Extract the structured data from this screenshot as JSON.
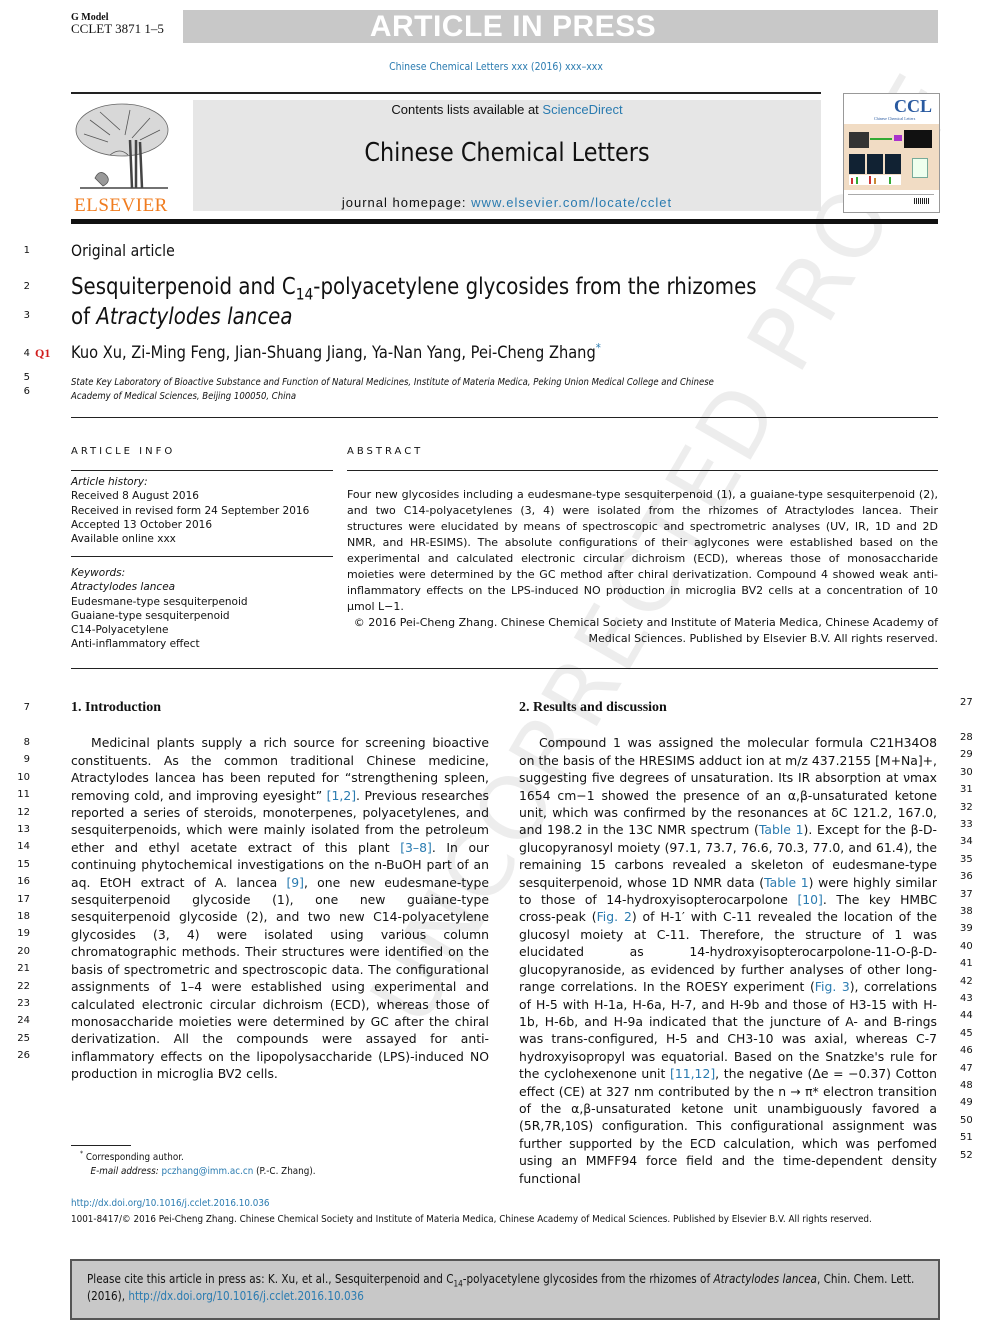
{
  "banner": {
    "g_model": "G Model",
    "manuscript_id": "CCLET 3871 1–5",
    "article_in_press": "ARTICLE IN PRESS",
    "journal_ref": "Chinese Chemical Letters xxx (2016) xxx–xxx"
  },
  "header": {
    "publisher_logo_text": "ELSEVIER",
    "contents_prefix": "Contents lists available at ",
    "contents_link": "ScienceDirect",
    "journal_title": "Chinese Chemical Letters",
    "homepage_prefix": "journal homepage: ",
    "homepage_link": "www.elsevier.com/locate/cclet",
    "cover_title": "CCL",
    "cover_subtitle": "Chinese Chemical Letters"
  },
  "article": {
    "type": "Original article",
    "title_line1_a": "Sesquiterpenoid and C",
    "title_sub": "14",
    "title_line1_b": "-polyacetylene glycosides from the rhizomes",
    "title_line2_a": "of ",
    "title_line2_italic": "Atractylodes lancea",
    "query_mark": "Q1",
    "authors": "Kuo Xu, Zi-Ming Feng, Jian-Shuang Jiang, Ya-Nan Yang, Pei-Cheng Zhang",
    "corresponding_mark": "*",
    "affiliation_line1": "State Key Laboratory of Bioactive Substance and Function of Natural Medicines, Institute of Materia Medica, Peking Union Medical College and Chinese",
    "affiliation_line2": "Academy of Medical Sciences, Beijing 100050, China"
  },
  "article_info": {
    "heading": "ARTICLE INFO",
    "history_label": "Article history:",
    "history": [
      "Received 8 August 2016",
      "Received in revised form 24 September 2016",
      "Accepted 13 October 2016",
      "Available online xxx"
    ],
    "keywords_label": "Keywords:",
    "keywords": [
      "Atractylodes lancea",
      "Eudesmane-type sesquiterpenoid",
      "Guaiane-type sesquiterpenoid",
      "C14-Polyacetylene",
      "Anti-inflammatory effect"
    ]
  },
  "abstract": {
    "heading": "ABSTRACT",
    "text": "Four new glycosides including a eudesmane-type sesquiterpenoid (1), a guaiane-type sesquiterpenoid (2), and two C14-polyacetylenes (3, 4) were isolated from the rhizomes of Atractylodes lancea. Their structures were elucidated by means of spectroscopic and spectrometric analyses (UV, IR, 1D and 2D NMR, and HR-ESIMS). The absolute configurations of their aglycones were established based on the experimental and calculated electronic circular dichroism (ECD), whereas those of monosaccharide moieties were determined by the GC method after chiral derivatization. Compound 4 showed weak anti-inflammatory effects on the LPS-induced NO production in microglia BV2 cells at a concentration of 10 μmol L−1.",
    "copyright_line1": "© 2016 Pei-Cheng Zhang. Chinese Chemical Society and Institute of Materia Medica, Chinese Academy of",
    "copyright_line2": "Medical Sciences. Published by Elsevier B.V. All rights reserved."
  },
  "intro": {
    "heading": "1. Introduction",
    "text": "Medicinal plants supply a rich source for screening bioactive constituents. As the common traditional Chinese medicine, Atractylodes lancea has been reputed for “strengthening spleen, removing cold, and improving eyesight” [1,2]. Previous researches reported a series of steroids, monoterpenes, polyacetylenes, and sesquiterpenoids, which were mainly isolated from the petroleum ether and ethyl acetate extract of this plant [3–8]. In our continuing phytochemical investigations on the n-BuOH part of an aq. EtOH extract of A. lancea [9], one new eudesmane-type sesquiterpenoid glycoside (1), one new guaiane-type sesquiterpenoid glycoside (2), and two new C14-polyacetylene glycosides (3, 4) were isolated using various column chromatographic methods. Their structures were identified on the basis of spectrometric and spectroscopic data. The configurational assignments of 1–4 were established using experimental and calculated electronic circular dichroism (ECD), whereas those of monosaccharide moieties were determined by GC after the chiral derivatization. All the compounds were assayed for anti-inflammatory effects on the lipopolysaccharide (LPS)-induced NO production in microglia BV2 cells.",
    "refs": [
      "[1,2]",
      "[3–8]",
      "[9]"
    ]
  },
  "results": {
    "heading": "2. Results and discussion",
    "text": "Compound 1 was assigned the molecular formula C21H34O8 on the basis of the HRESIMS adduct ion at m/z 437.2155 [M+Na]+, suggesting five degrees of unsaturation. Its IR absorption at νmax 1654 cm−1 showed the presence of an α,β-unsaturated ketone unit, which was confirmed by the resonances at δC 121.2, 167.0, and 198.2 in the 13C NMR spectrum (Table 1). Except for the β-D-glucopyranosyl moiety (97.1, 73.7, 76.6, 70.3, 77.0, and 61.4), the remaining 15 carbons revealed a skeleton of eudesmane-type sesquiterpenoid, whose 1D NMR data (Table 1) were highly similar to those of 14-hydroxyisopterocarpolone [10]. The key HMBC cross-peak (Fig. 2) of H-1′ with C-11 revealed the location of the glucosyl moiety at C-11. Therefore, the structure of 1 was elucidated as 14-hydroxyisopterocarpolone-11-O-β-D-glucopyranoside, as evidenced by further analyses of other long-range correlations. In the ROESY experiment (Fig. 3), correlations of H-5 with H-1a, H-6a, H-7, and H-9b and those of H3-15 with H-1b, H-6b, and H-9a indicated that the juncture of A- and B-rings was trans-configured, H-5 and CH3-10 was axial, whereas C-7 hydroxyisopropyl was equatorial. Based on the Snatzke's rule for the cyclohexenone unit [11,12], the negative (Δe = −0.37) Cotton effect (CE) at 327 nm contributed by the n → π* electron transition of the α,β-unsaturated ketone unit unambiguously favored a (5R,7R,10S) configuration. This configurational assignment was further supported by the ECD calculation, which was perfomed using an MMFF94 force field and the time-dependent density functional",
    "links": [
      "Table 1",
      "Table 1",
      "[10]",
      "Fig. 2",
      "Fig. 3",
      "[11,12]"
    ]
  },
  "line_numbers": {
    "left": [
      "1",
      "2",
      "3",
      "4",
      "5",
      "6",
      "7",
      "8",
      "9",
      "10",
      "11",
      "12",
      "13",
      "14",
      "15",
      "16",
      "17",
      "18",
      "19",
      "20",
      "21",
      "22",
      "23",
      "24",
      "25",
      "26"
    ],
    "right": [
      "27",
      "28",
      "29",
      "30",
      "31",
      "32",
      "33",
      "34",
      "35",
      "36",
      "37",
      "38",
      "39",
      "40",
      "41",
      "42",
      "43",
      "44",
      "45",
      "46",
      "47",
      "48",
      "49",
      "50",
      "51",
      "52"
    ]
  },
  "footnote": {
    "mark": "*",
    "corresponding": "Corresponding author.",
    "email_label": "E-mail address: ",
    "email": "pczhang@imm.ac.cn",
    "email_suffix": " (P.-C. Zhang)."
  },
  "footer": {
    "doi": "http://dx.doi.org/10.1016/j.cclet.2016.10.036",
    "issn_line": "1001-8417/© 2016 Pei-Cheng Zhang. Chinese Chemical Society and Institute of Materia Medica, Chinese Academy of Medical Sciences. Published by Elsevier B.V. All rights reserved."
  },
  "citation_box": {
    "prefix": "Please cite this article in press as: K. Xu, et al., Sesquiterpenoid and C",
    "sub": "14",
    "middle": "-polyacetylene glycosides from the rhizomes of ",
    "italic": "Atractylodes lancea",
    "suffix": ", Chin. Chem. Lett. (2016), ",
    "doi_link": "http://dx.doi.org/10.1016/j.cclet.2016.10.036"
  },
  "watermark": "UNCORRECTED PROOF",
  "colors": {
    "link": "#2a7bb0",
    "elsevier_orange": "#f07c1f",
    "query_red": "#d01c1c",
    "banner_gray": "#c8c8c8"
  }
}
